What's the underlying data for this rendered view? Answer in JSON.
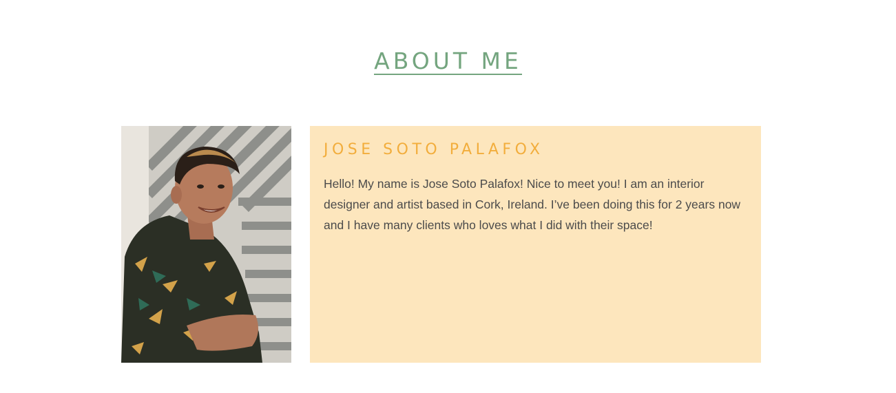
{
  "section": {
    "title": "ABOUT ME"
  },
  "profile": {
    "photo_alt": "Portrait of Jose Soto Palafox",
    "name": "JOSE SOTO PALAFOX",
    "bio": "Hello! My name is Jose Soto Palafox! Nice to meet you! I am an interior designer and artist based in Cork, Ireland. I’ve been doing this for 2 years now and I have many clients who loves what I did with their space!"
  },
  "colors": {
    "heading": "#74a57f",
    "name": "#f2ad3c",
    "card_background": "#fde6bd",
    "body_text": "#4b4b4b"
  }
}
